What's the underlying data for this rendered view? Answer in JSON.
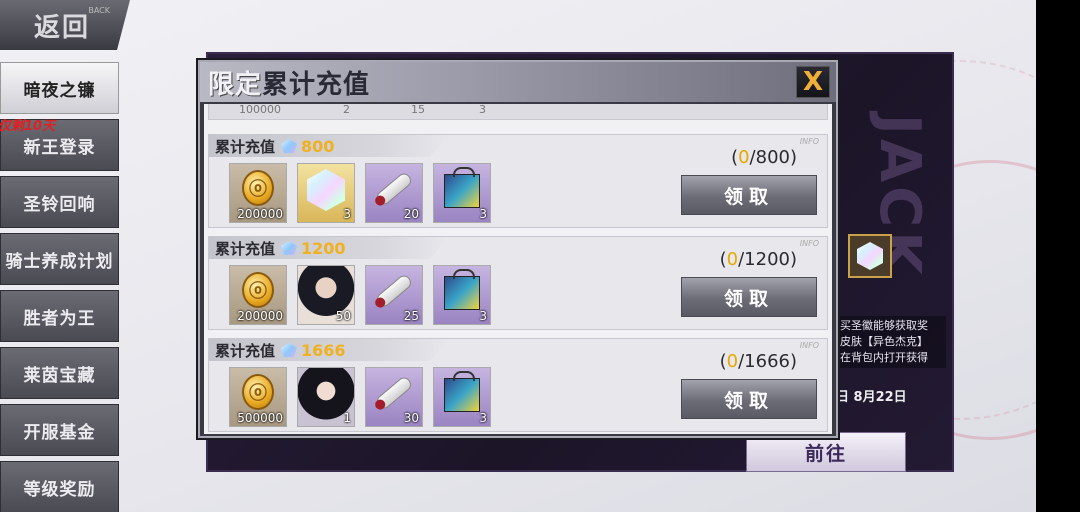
{
  "nav": {
    "back_label": "返回",
    "back_sub": "BACK",
    "limit_tag": "仅剩10天",
    "items": [
      {
        "label": "暗夜之镰",
        "active": true
      },
      {
        "label": "新王登录",
        "active": false
      },
      {
        "label": "圣铃回响",
        "active": false
      },
      {
        "label": "骑士养成计划",
        "active": false
      },
      {
        "label": "胜者为王",
        "active": false
      },
      {
        "label": "莱茵宝藏",
        "active": false
      },
      {
        "label": "开服基金",
        "active": false
      },
      {
        "label": "等级奖励",
        "active": false
      }
    ]
  },
  "background_event": {
    "big_letters": "JACK",
    "desc": "买圣徽能够获取奖 皮肤【异色杰克】 在背包内打开获得",
    "date": "日 8月22日",
    "go_label": "前往"
  },
  "modal": {
    "title_part1": "限定",
    "title_part2": "累计充值",
    "close_label": "X",
    "prev_row_values": [
      "100000",
      "2",
      "15",
      "3"
    ],
    "rows": [
      {
        "label": "累计充值",
        "amount": "800",
        "info": "INFO",
        "progress_current": "0",
        "progress_total": "/800)",
        "progress_open": "(",
        "claim_label": "领取",
        "items": [
          {
            "type": "coin",
            "count": "200000"
          },
          {
            "type": "crystal",
            "count": "3"
          },
          {
            "type": "scroll",
            "count": "20"
          },
          {
            "type": "bag",
            "count": "3"
          }
        ]
      },
      {
        "label": "累计充值",
        "amount": "1200",
        "info": "INFO",
        "progress_current": "0",
        "progress_total": "/1200)",
        "progress_open": "(",
        "claim_label": "领取",
        "items": [
          {
            "type": "coin",
            "count": "200000"
          },
          {
            "type": "portrait",
            "count": "50"
          },
          {
            "type": "scroll",
            "count": "25"
          },
          {
            "type": "bag",
            "count": "3"
          }
        ]
      },
      {
        "label": "累计充值",
        "amount": "1666",
        "info": "INFO",
        "progress_current": "0",
        "progress_total": "/1666)",
        "progress_open": "(",
        "claim_label": "领取",
        "items": [
          {
            "type": "coin",
            "count": "500000"
          },
          {
            "type": "portrait",
            "count": "1"
          },
          {
            "type": "scroll",
            "count": "30"
          },
          {
            "type": "bag",
            "count": "3"
          }
        ]
      }
    ]
  },
  "colors": {
    "accent_gold": "#f0b020",
    "close_x": "#f0b038",
    "limit_red": "#e02020"
  }
}
